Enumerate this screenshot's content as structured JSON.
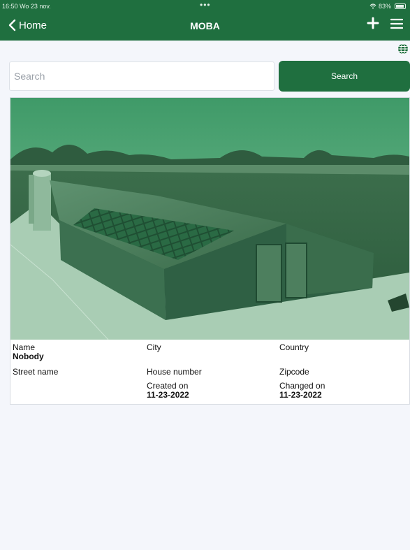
{
  "status_bar": {
    "time": "16:50",
    "date": "Wo 23 nov.",
    "battery": "83%"
  },
  "nav": {
    "back_label": "Home",
    "title": "MOBA"
  },
  "search": {
    "placeholder": "Search",
    "value": "",
    "button_label": "Search"
  },
  "card": {
    "name_label": "Name",
    "name_value": "Nobody",
    "city_label": "City",
    "country_label": "Country",
    "street_label": "Street name",
    "house_number_label": "House number",
    "zipcode_label": "Zipcode",
    "created_label": "Created on",
    "created_value": "11-23-2022",
    "changed_label": "Changed on",
    "changed_value": "11-23-2022"
  },
  "colors": {
    "brand_green": "#1f6f3f",
    "page_background": "#f4f6fb"
  },
  "icons": [
    "chevron-left-icon",
    "plus-icon",
    "menu-icon",
    "globe-icon",
    "wifi-icon",
    "battery-icon"
  ]
}
